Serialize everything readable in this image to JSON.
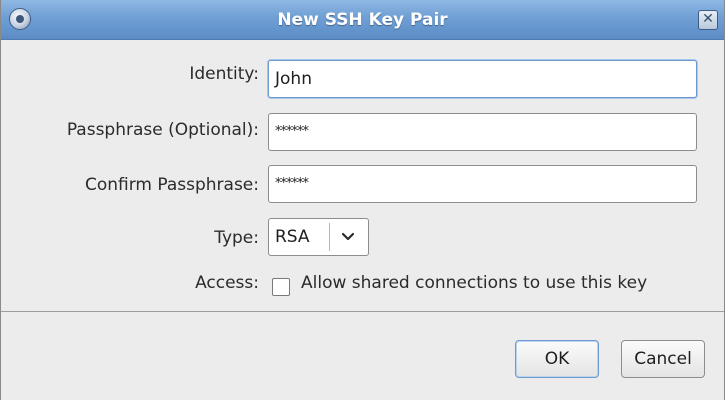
{
  "dialog": {
    "title": "New SSH Key Pair",
    "close_glyph": "✕"
  },
  "form": {
    "identity_label": "Identity:",
    "identity_value": "John",
    "passphrase_label": "Passphrase (Optional):",
    "passphrase_value": "******",
    "confirm_label": "Confirm Passphrase:",
    "confirm_value": "******",
    "type_label": "Type:",
    "type_value": "RSA",
    "access_label": "Access:",
    "access_checkbox_label": "Allow shared connections to use this key",
    "access_checked": false
  },
  "buttons": {
    "ok_label": "OK",
    "cancel_label": "Cancel"
  },
  "colors": {
    "titlebar": "#6f9fd4",
    "focus_border": "#6e9ad0"
  },
  "icons": {
    "window_menu": "window-menu-icon",
    "close": "close-icon",
    "dropdown": "chevron-down-icon"
  }
}
